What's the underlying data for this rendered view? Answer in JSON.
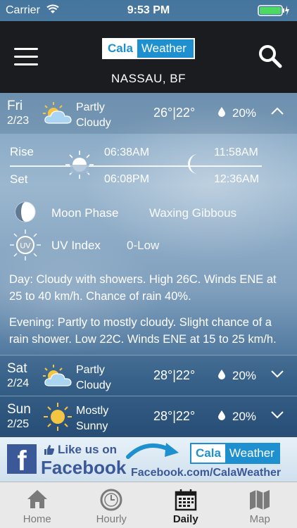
{
  "status_bar": {
    "carrier": "Carrier",
    "time": "9:53 PM"
  },
  "header": {
    "logo_left": "Cala",
    "logo_right": "Weather",
    "location": "NASSAU, BF"
  },
  "days": [
    {
      "name": "Fri",
      "date": "2/23",
      "condition": "Partly Cloudy",
      "condition_icon": "partly-cloudy-icon",
      "high": "26°",
      "separator": "|",
      "low": "22°",
      "precip": "20%",
      "expanded": true
    },
    {
      "name": "Sat",
      "date": "2/24",
      "condition": "Partly Cloudy",
      "condition_icon": "partly-cloudy-icon",
      "high": "28°",
      "separator": "|",
      "low": "22°",
      "precip": "20%",
      "expanded": false
    },
    {
      "name": "Sun",
      "date": "2/25",
      "condition": "Mostly Sunny",
      "condition_icon": "mostly-sunny-icon",
      "high": "28°",
      "separator": "|",
      "low": "22°",
      "precip": "20%",
      "expanded": false
    }
  ],
  "detail": {
    "rise_label": "Rise",
    "set_label": "Set",
    "sun_rise": "06:38AM",
    "sun_set": "06:08PM",
    "moon_rise": "11:58AM",
    "moon_set": "12:36AM",
    "moon_phase_label": "Moon Phase",
    "moon_phase_value": "Waxing Gibbous",
    "uv_label": "UV Index",
    "uv_value": "0-Low",
    "uv_icon_text": "UV",
    "day_label": "Day",
    "day_text": ": Cloudy with showers. High 26C. Winds ENE at 25 to 40 km/h. Chance of rain 40%.",
    "evening_label": "Evening",
    "evening_text": ": Partly to mostly cloudy. Slight chance of a rain shower. Low 22C. Winds ENE at 15 to 25 km/h."
  },
  "banner": {
    "fb_letter": "f",
    "like_text": "Like us on",
    "facebook_text": "Facebook",
    "logo_left": "Cala",
    "logo_right": "Weather",
    "url": "Facebook.com/CalaWeather"
  },
  "tabs": [
    {
      "label": "Home",
      "icon": "home-icon",
      "active": false
    },
    {
      "label": "Hourly",
      "icon": "clock-icon",
      "active": false
    },
    {
      "label": "Daily",
      "icon": "calendar-icon",
      "active": true
    },
    {
      "label": "Map",
      "icon": "map-icon",
      "active": false
    }
  ],
  "colors": {
    "header_bg": "#1a1c20",
    "brand_blue": "#1e90d0",
    "facebook_blue": "#3b5998",
    "tab_bar_bg": "#e9e9e9"
  }
}
